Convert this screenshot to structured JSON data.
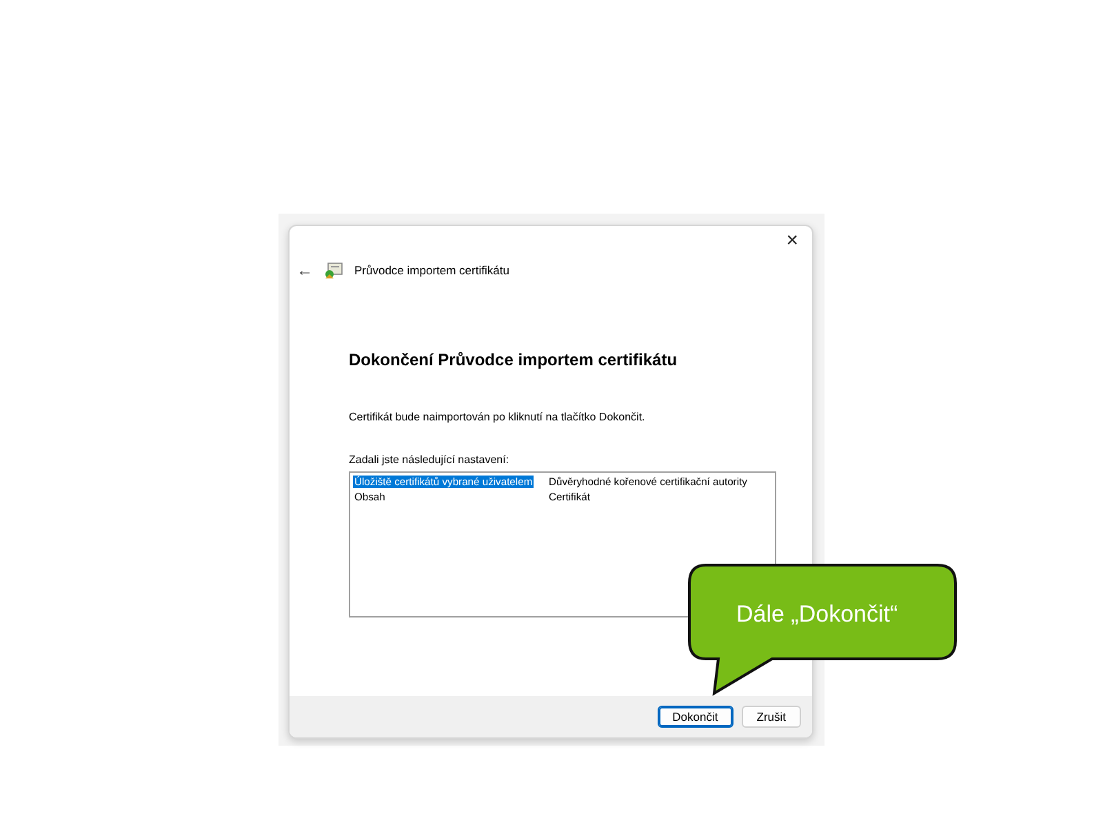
{
  "dialog": {
    "back_button": "←",
    "wizard_title": "Průvodce importem certifikátu",
    "close_button": "×",
    "heading": "Dokončení Průvodce importem certifikátu",
    "description": "Certifikát bude naimportován po kliknutí na tlačítko Dokončit.",
    "settings_label": "Zadali jste následující nastavení:",
    "settings": [
      {
        "name": "Úložiště certifikátů vybrané uživatelem",
        "value": "Důvěryhodné kořenové certifikační autority",
        "selected": true
      },
      {
        "name": "Obsah",
        "value": "Certifikát",
        "selected": false
      }
    ],
    "buttons": [
      {
        "label": "Dokončit",
        "default": true
      },
      {
        "label": "Zrušit",
        "default": false
      }
    ]
  },
  "callout": {
    "text": "Dále „Dokončit“"
  }
}
